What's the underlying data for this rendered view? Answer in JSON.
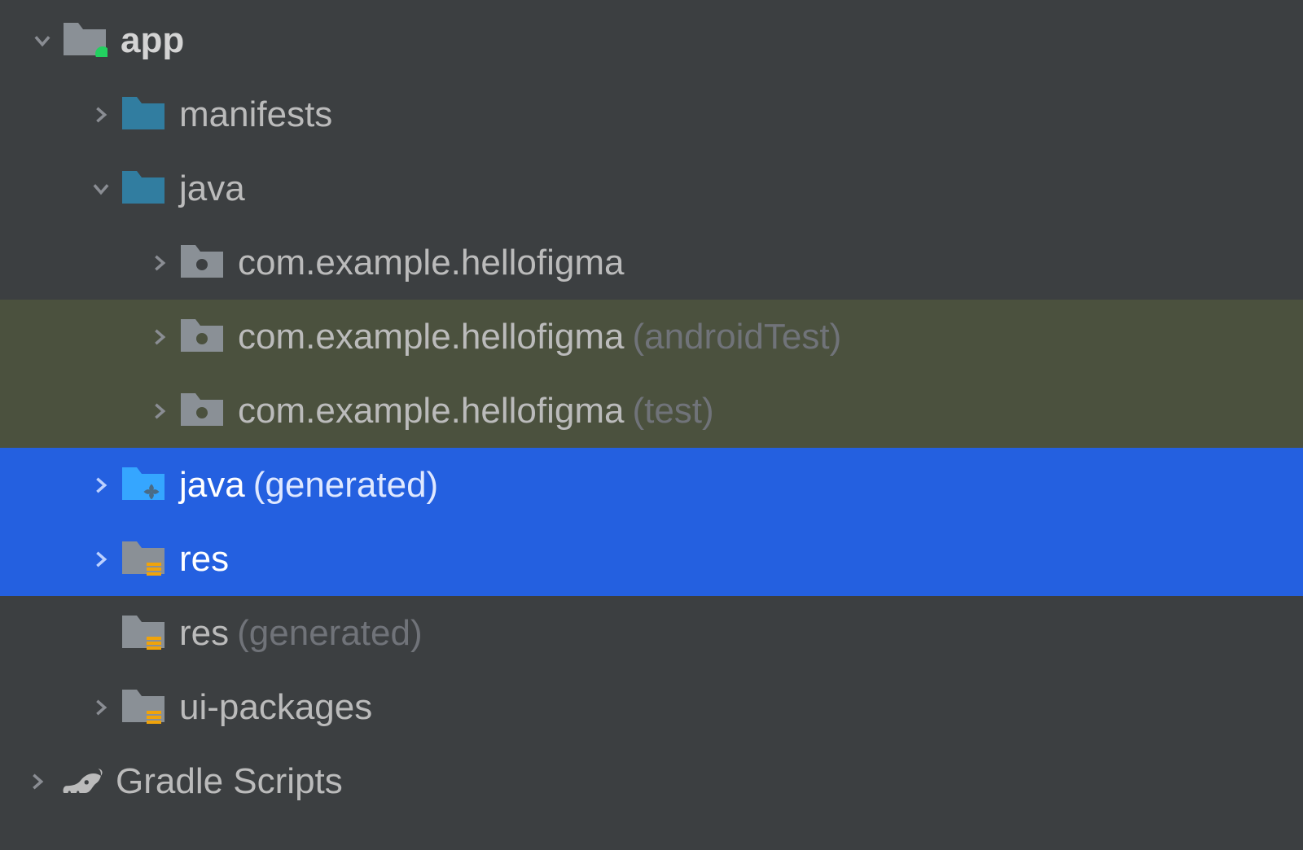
{
  "tree": {
    "app_label": "app",
    "manifests": "manifests",
    "java": "java",
    "package_main": "com.example.hellofigma",
    "package_androidtest": "com.example.hellofigma",
    "package_androidtest_suffix": "(androidTest)",
    "package_test": "com.example.hellofigma",
    "package_test_suffix": "(test)",
    "java_generated": "java",
    "java_generated_suffix": "(generated)",
    "res": "res",
    "res_generated": "res",
    "res_generated_suffix": "(generated)",
    "ui_packages": "ui-packages",
    "gradle_scripts": "Gradle Scripts"
  },
  "colors": {
    "folder_teal": "#317da0",
    "folder_gray": "#8a9096",
    "folder_lightblue": "#35a6ff",
    "selection_blue": "#2460e0",
    "highlight_green": "#4b513e",
    "dot_green": "#23d160",
    "res_bars": "#f0a30a"
  }
}
